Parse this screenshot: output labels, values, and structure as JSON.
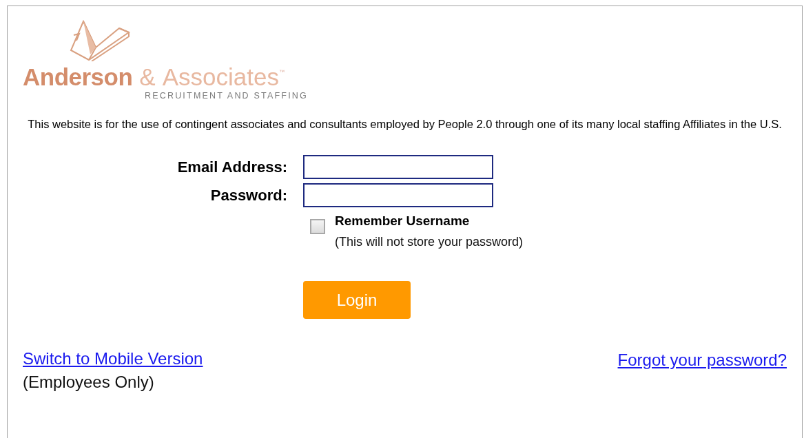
{
  "logo": {
    "name_bold": "Anderson",
    "ampersand": "&",
    "name_light": "Associates",
    "trademark": "™",
    "tagline": "RECRUITMENT AND STAFFING"
  },
  "notice": "This website is for the use of contingent associates and consultants employed by People 2.0 through one of its many local staffing Affiliates in the U.S.",
  "form": {
    "fields": [
      {
        "label": "Email Address:"
      },
      {
        "label": "Password:"
      }
    ],
    "remember": {
      "label": "Remember Username",
      "note": "(This will not store your password)",
      "checked": false
    },
    "button": "Login"
  },
  "footer": {
    "mobile_link": "Switch to Mobile Version",
    "mobile_note": "(Employees Only)",
    "forgot_link": "Forgot your password?"
  }
}
